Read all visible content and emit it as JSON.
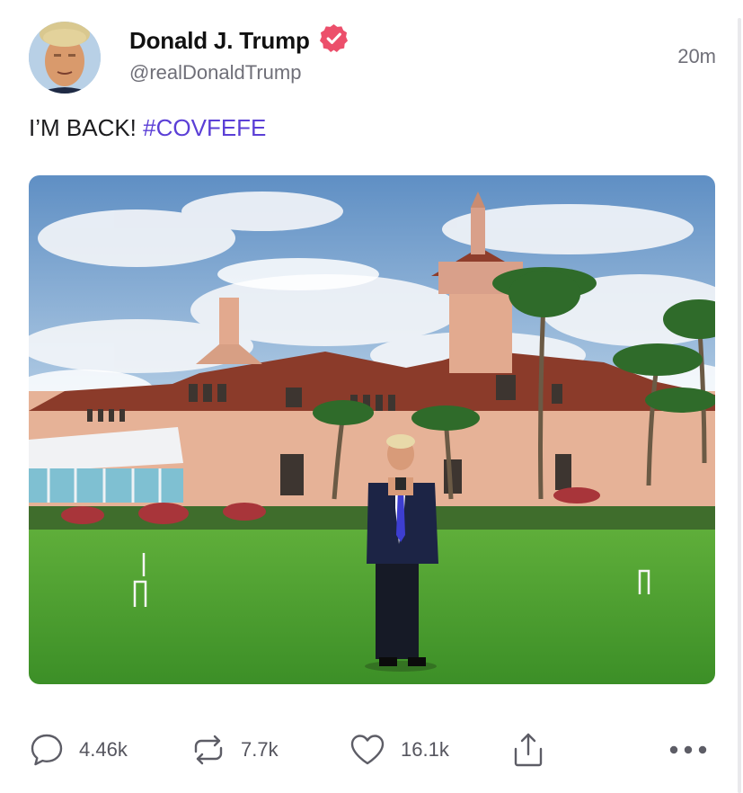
{
  "post": {
    "author": {
      "display_name": "Donald J. Trump",
      "handle": "@realDonaldTrump",
      "verified": true,
      "avatar_icon": "user-avatar"
    },
    "timestamp": "20m",
    "text_prefix": "I’M BACK! ",
    "hashtag": "#COVFEFE",
    "media": {
      "kind": "photo"
    },
    "actions": {
      "reply": {
        "icon": "speech-bubble-icon",
        "count": "4.46k"
      },
      "repost": {
        "icon": "repost-arrows-icon",
        "count": "7.7k"
      },
      "like": {
        "icon": "heart-icon",
        "count": "16.1k"
      },
      "share": {
        "icon": "share-icon"
      },
      "more": {
        "icon": "more-dots-icon"
      }
    }
  },
  "colors": {
    "hashtag": "#5b3fd6",
    "verified_badge": "#ec4f6b",
    "secondary_text": "#6f6f78"
  }
}
